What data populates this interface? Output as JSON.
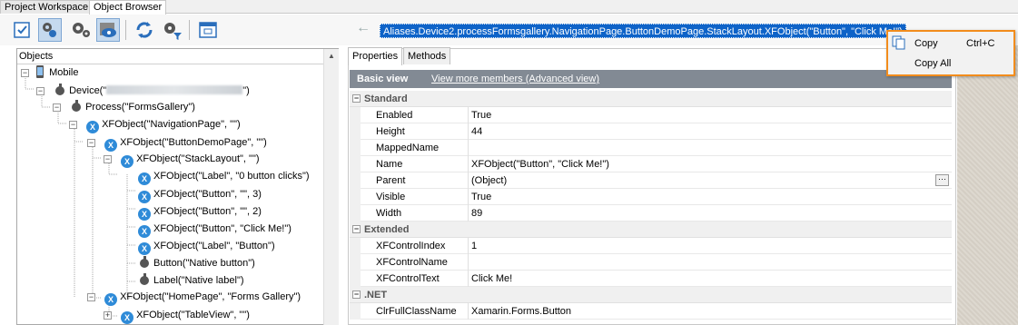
{
  "tabs": {
    "project_workspace": "Project Workspace",
    "object_browser": "Object Browser"
  },
  "address": {
    "path": "Aliases.Device2.processFormsgallery.NavigationPage.ButtonDemoPage.StackLayout.XFObject(\"Button\", \"Click Me!\")"
  },
  "tree": {
    "header": "Objects",
    "nodes": [
      {
        "label": "Mobile"
      },
      {
        "label_prefix": "Device(\"",
        "label_suffix": "\")"
      },
      {
        "label": "Process(\"FormsGallery\")"
      },
      {
        "label": "XFObject(\"NavigationPage\", \"\")"
      },
      {
        "label": "XFObject(\"ButtonDemoPage\", \"\")"
      },
      {
        "label": "XFObject(\"StackLayout\", \"\")"
      },
      {
        "label": "XFObject(\"Label\", \"0 button clicks\")"
      },
      {
        "label": "XFObject(\"Button\", \"\", 3)"
      },
      {
        "label": "XFObject(\"Button\", \"\", 2)"
      },
      {
        "label": "XFObject(\"Button\", \"Click Me!\")"
      },
      {
        "label": "XFObject(\"Label\", \"Button\")"
      },
      {
        "label": "Button(\"Native button\")"
      },
      {
        "label": "Label(\"Native label\")"
      },
      {
        "label": "XFObject(\"HomePage\", \"Forms Gallery\")"
      },
      {
        "label": "XFObject(\"TableView\", \"\")"
      }
    ]
  },
  "panel": {
    "tab_properties": "Properties",
    "tab_methods": "Methods",
    "basic_view": "Basic view",
    "more_members": "View more members (Advanced view)"
  },
  "properties": {
    "standard": {
      "title": "Standard",
      "rows": [
        {
          "k": "Enabled",
          "v": "True"
        },
        {
          "k": "Height",
          "v": "44"
        },
        {
          "k": "MappedName",
          "v": ""
        },
        {
          "k": "Name",
          "v": "XFObject(\"Button\", \"Click Me!\")"
        },
        {
          "k": "Parent",
          "v": "(Object)"
        },
        {
          "k": "Visible",
          "v": "True"
        },
        {
          "k": "Width",
          "v": "89"
        }
      ]
    },
    "extended": {
      "title": "Extended",
      "rows": [
        {
          "k": "XFControlIndex",
          "v": "1"
        },
        {
          "k": "XFControlName",
          "v": ""
        },
        {
          "k": "XFControlText",
          "v": "Click Me!"
        }
      ]
    },
    "net": {
      "title": ".NET",
      "rows": [
        {
          "k": "ClrFullClassName",
          "v": "Xamarin.Forms.Button"
        }
      ]
    }
  },
  "context_menu": {
    "copy": "Copy",
    "copy_shortcut": "Ctrl+C",
    "copy_all": "Copy All"
  },
  "colors": {
    "selection": "#0e63c8",
    "menu_border": "#f28c1c",
    "xf_icon": "#2f8bd8"
  }
}
